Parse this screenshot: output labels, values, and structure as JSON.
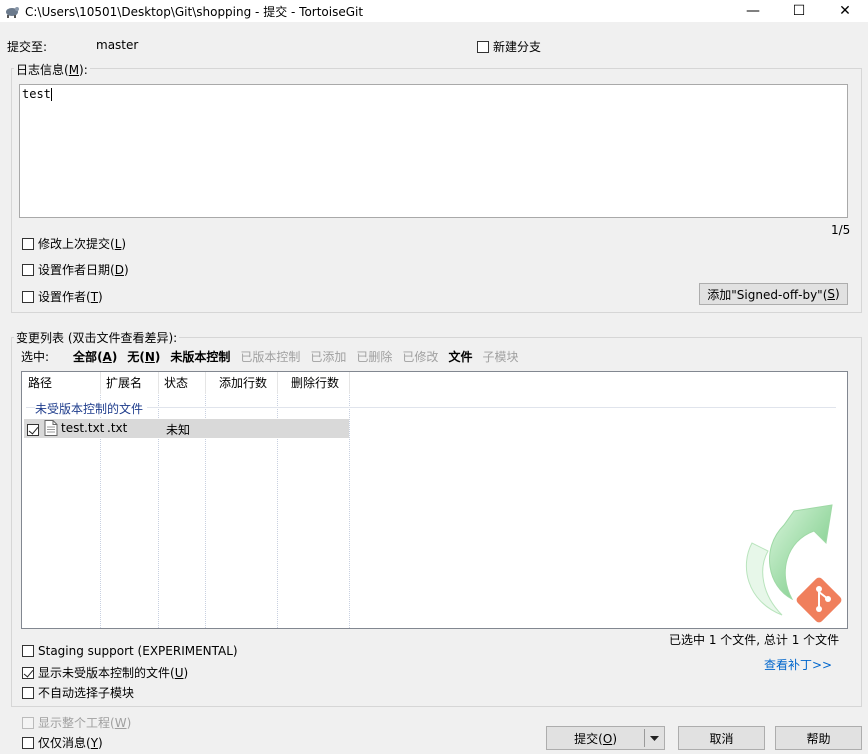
{
  "window": {
    "title": "C:\\Users\\10501\\Desktop\\Git\\shopping - 提交 - TortoiseGit",
    "minimize": "—",
    "maximize": "☐",
    "close": "✕"
  },
  "header": {
    "commit_to_label": "提交至:",
    "branch": "master",
    "new_branch_label": "新建分支"
  },
  "log": {
    "group_label_pre": "日志信息(",
    "group_label_key": "M",
    "group_label_post": "):",
    "message": "test",
    "position": "1/5",
    "amend_label": "修改上次提交",
    "amend_key": "L",
    "set_date_label": "设置作者日期",
    "set_date_key": "D",
    "set_author_label": "设置作者",
    "set_author_key": "T",
    "signoff_pre": "添加\"Signed-off-by\"(",
    "signoff_key": "S",
    "signoff_post": ")"
  },
  "changes": {
    "group_label": "变更列表 (双击文件查看差异):",
    "select_label": "选中:",
    "filters": [
      {
        "label": "全部",
        "key": "A",
        "active": true
      },
      {
        "label": "无",
        "key": "N",
        "active": true
      },
      {
        "label": "未版本控制",
        "key": "",
        "active": true
      },
      {
        "label": "已版本控制",
        "key": "",
        "active": false
      },
      {
        "label": "已添加",
        "key": "",
        "active": false
      },
      {
        "label": "已删除",
        "key": "",
        "active": false
      },
      {
        "label": "已修改",
        "key": "",
        "active": false
      },
      {
        "label": "文件",
        "key": "",
        "active": true
      },
      {
        "label": "子模块",
        "key": "",
        "active": false
      }
    ],
    "columns": [
      "路径",
      "扩展名",
      "状态",
      "添加行数",
      "删除行数"
    ],
    "group_header": "未受版本控制的文件",
    "rows": [
      {
        "path": "test.txt",
        "ext": ".txt",
        "status": "未知",
        "added": "",
        "deleted": "",
        "checked": true
      }
    ],
    "summary": "已选中 1 个文件, 总计 1 个文件",
    "view_patch": "查看补丁>>"
  },
  "options": {
    "staging": "Staging support (EXPERIMENTAL)",
    "show_unversioned_pre": "显示未受版本控制的文件(",
    "show_unversioned_key": "U",
    "no_autoselect_submodules": "不自动选择子模块",
    "show_whole_project_pre": "显示整个工程(",
    "show_whole_project_key": "W",
    "message_only_pre": "仅仅消息(",
    "message_only_key": "Y"
  },
  "buttons": {
    "commit_pre": "提交(",
    "commit_key": "O",
    "cancel": "取消",
    "help": "帮助"
  },
  "colors": {
    "link": "#0066cc",
    "group_header": "#1e3c8c",
    "selected_row": "#d9d9d9",
    "logo_green": "#7fd08a"
  }
}
